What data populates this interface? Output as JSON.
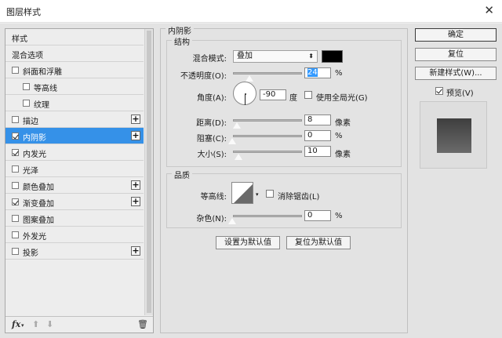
{
  "window": {
    "title": "图层样式",
    "close_icon": "close-icon"
  },
  "left_panel": {
    "header": "样式",
    "items": [
      {
        "label": "混合选项",
        "checkbox": false,
        "plus": false
      },
      {
        "label": "斜面和浮雕",
        "checkbox": true,
        "checked": false,
        "plus": false
      },
      {
        "label": "等高线",
        "checkbox": true,
        "checked": false,
        "plus": false
      },
      {
        "label": "纹理",
        "checkbox": true,
        "checked": false,
        "plus": false
      },
      {
        "label": "描边",
        "checkbox": true,
        "checked": false,
        "plus": true
      },
      {
        "label": "内阴影",
        "checkbox": true,
        "checked": true,
        "plus": true,
        "selected": true
      },
      {
        "label": "内发光",
        "checkbox": true,
        "checked": true,
        "plus": false
      },
      {
        "label": "光泽",
        "checkbox": true,
        "checked": false,
        "plus": false
      },
      {
        "label": "颜色叠加",
        "checkbox": true,
        "checked": false,
        "plus": true
      },
      {
        "label": "渐变叠加",
        "checkbox": true,
        "checked": true,
        "plus": true
      },
      {
        "label": "图案叠加",
        "checkbox": true,
        "checked": false,
        "plus": false
      },
      {
        "label": "外发光",
        "checkbox": true,
        "checked": false,
        "plus": false
      },
      {
        "label": "投影",
        "checkbox": true,
        "checked": false,
        "plus": true
      }
    ],
    "footer": {
      "fx": "fx",
      "fx_sub": "▾",
      "up": "⬆",
      "down": "⬇",
      "trash": "🗑"
    }
  },
  "inner_shadow": {
    "section_title": "内阴影",
    "structure": {
      "title": "结构",
      "blend_mode_label": "混合模式:",
      "blend_mode_value": "叠加",
      "color": "#000000",
      "opacity_label": "不透明度(O):",
      "opacity_value": "24",
      "opacity_fraction": 0.24,
      "opacity_unit": "%",
      "angle_label": "角度(A):",
      "angle_value": "-90",
      "angle_unit": "度",
      "global_light_label": "使用全局光(G)",
      "global_light_checked": false,
      "distance_label": "距离(D):",
      "distance_value": "8",
      "distance_unit": "像素",
      "choke_label": "阻塞(C):",
      "choke_value": "0",
      "choke_unit": "%",
      "size_label": "大小(S):",
      "size_value": "10",
      "size_unit": "像素"
    },
    "quality": {
      "title": "品质",
      "contour_label": "等高线:",
      "antialias_label": "消除锯齿(L)",
      "antialias_checked": false,
      "noise_label": "杂色(N):",
      "noise_value": "0",
      "noise_unit": "%"
    },
    "make_default": "设置为默认值",
    "reset_default": "复位为默认值"
  },
  "right_panel": {
    "ok": "确定",
    "reset": "复位",
    "new_style": "新建样式(W)...",
    "preview_label": "预览(V)",
    "preview_checked": true
  }
}
